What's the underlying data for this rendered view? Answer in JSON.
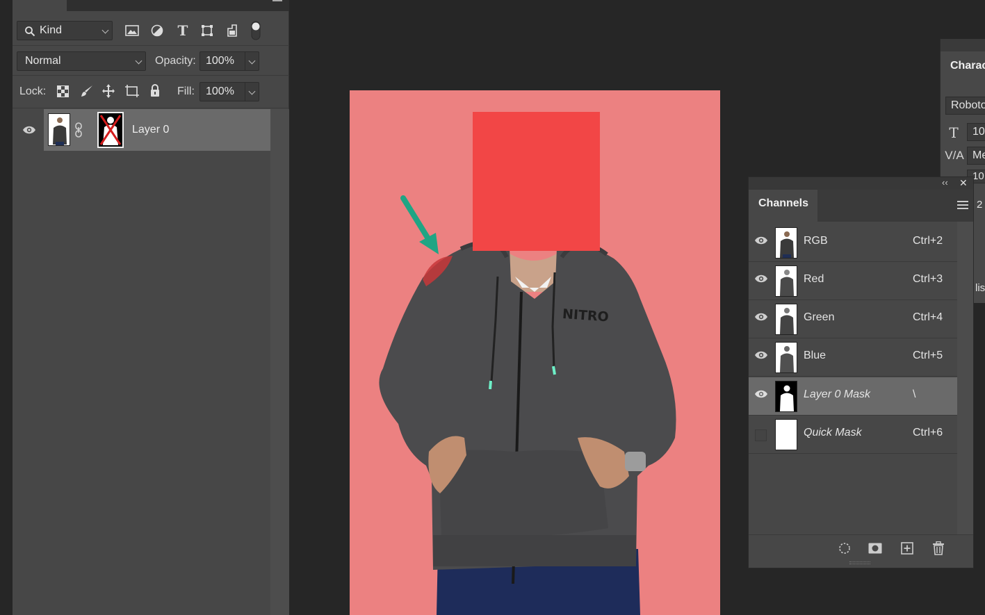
{
  "layers_panel": {
    "filter": {
      "label": "Kind",
      "icons": [
        "image-filter-icon",
        "adjustment-filter-icon",
        "type-filter-icon",
        "shape-filter-icon",
        "smart-object-filter-icon",
        "filter-toggle-icon"
      ]
    },
    "blend_mode": "Normal",
    "opacity_label": "Opacity:",
    "opacity_value": "100%",
    "lock_label": "Lock:",
    "fill_label": "Fill:",
    "fill_value": "100%",
    "layers": [
      {
        "name": "Layer 0",
        "visible": true
      }
    ]
  },
  "character_panel": {
    "title": "Charac",
    "font": "Roboto",
    "size": "10",
    "kerning": "Me",
    "leading": "10",
    "tracking": "2",
    "misc": "lis"
  },
  "channels_panel": {
    "collapse_glyph": "‹‹",
    "close_glyph": "✕",
    "tab": "Channels",
    "channels": [
      {
        "name": "RGB",
        "shortcut": "Ctrl+2",
        "visible": true,
        "italic": false,
        "selected": false
      },
      {
        "name": "Red",
        "shortcut": "Ctrl+3",
        "visible": true,
        "italic": false,
        "selected": false
      },
      {
        "name": "Green",
        "shortcut": "Ctrl+4",
        "visible": true,
        "italic": false,
        "selected": false
      },
      {
        "name": "Blue",
        "shortcut": "Ctrl+5",
        "visible": true,
        "italic": false,
        "selected": false
      },
      {
        "name": "Layer 0 Mask",
        "shortcut": "\\",
        "visible": true,
        "italic": true,
        "selected": true
      },
      {
        "name": "Quick Mask",
        "shortcut": "Ctrl+6",
        "visible": false,
        "italic": true,
        "selected": false
      }
    ]
  },
  "canvas": {
    "background_color": "#ec8181",
    "redaction_color": "#f24646",
    "arrow_color": "#1fa584",
    "logo_text": "NITRO"
  }
}
